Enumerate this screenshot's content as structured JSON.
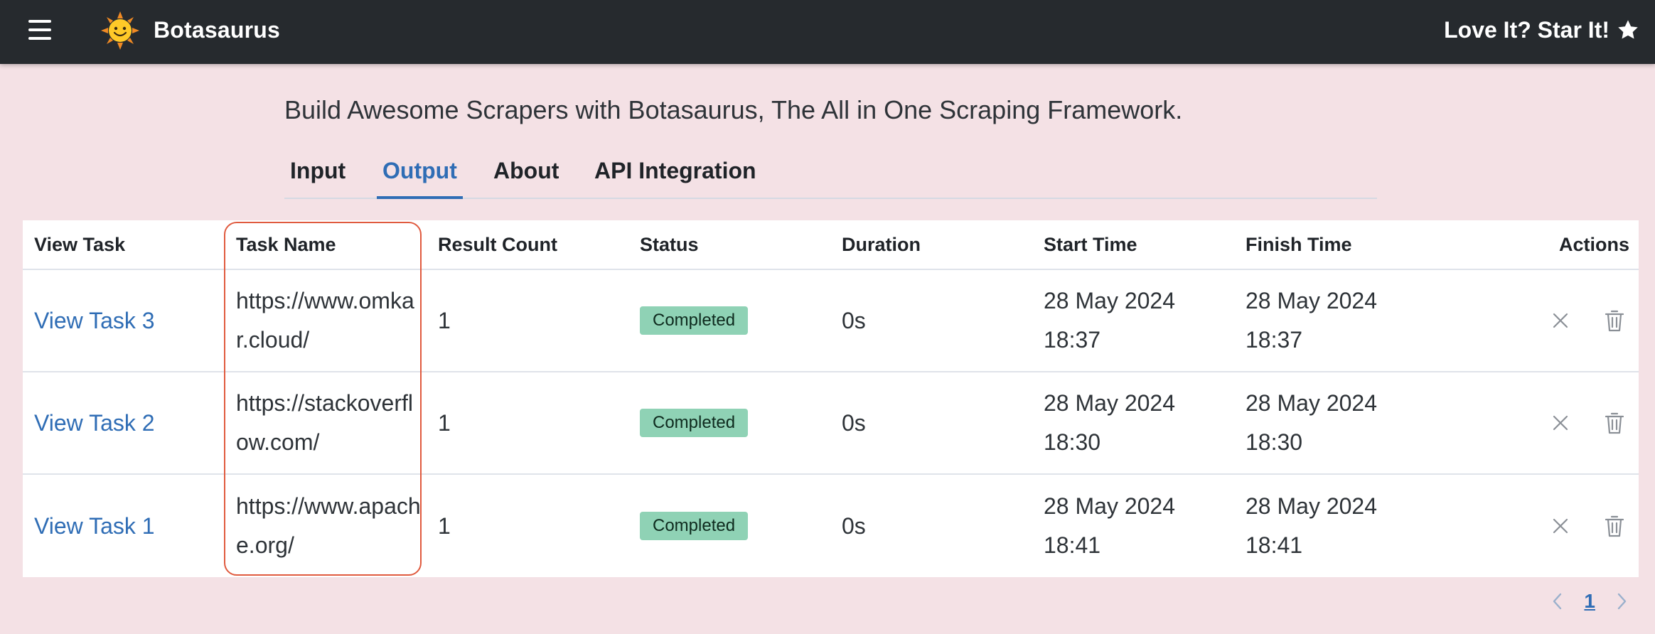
{
  "app": {
    "brand": "Botasaurus",
    "star_cta": "Love It? Star It!"
  },
  "icons": {
    "menu": "hamburger-icon",
    "logo": "sun-logo-icon",
    "star": "star-icon",
    "cancel": "close-icon",
    "delete": "trash-icon"
  },
  "colors": {
    "topbar": "#262a2e",
    "background": "#f4e1e5",
    "accent": "#2f6db5",
    "status_completed": "#8fd2b5",
    "highlight": "#e05a3e"
  },
  "tagline": "Build Awesome Scrapers with Botasaurus, The All in One Scraping Framework.",
  "tabs": [
    {
      "label": "Input",
      "active": false
    },
    {
      "label": "Output",
      "active": true
    },
    {
      "label": "About",
      "active": false
    },
    {
      "label": "API Integration",
      "active": false
    }
  ],
  "table": {
    "columns": [
      "View Task",
      "Task Name",
      "Result Count",
      "Status",
      "Duration",
      "Start Time",
      "Finish Time",
      "Actions"
    ],
    "rows": [
      {
        "view": "View Task 3",
        "name": "https://www.omkar.cloud/",
        "count": "1",
        "status": "Completed",
        "duration": "0s",
        "start_date": "28 May 2024",
        "start_time": "18:37",
        "finish_date": "28 May 2024",
        "finish_time": "18:37"
      },
      {
        "view": "View Task 2",
        "name": "https://stackoverflow.com/",
        "count": "1",
        "status": "Completed",
        "duration": "0s",
        "start_date": "28 May 2024",
        "start_time": "18:30",
        "finish_date": "28 May 2024",
        "finish_time": "18:30"
      },
      {
        "view": "View Task 1",
        "name": "https://www.apache.org/",
        "count": "1",
        "status": "Completed",
        "duration": "0s",
        "start_date": "28 May 2024",
        "start_time": "18:41",
        "finish_date": "28 May 2024",
        "finish_time": "18:41"
      }
    ]
  },
  "pagination": {
    "current_page": "1"
  }
}
